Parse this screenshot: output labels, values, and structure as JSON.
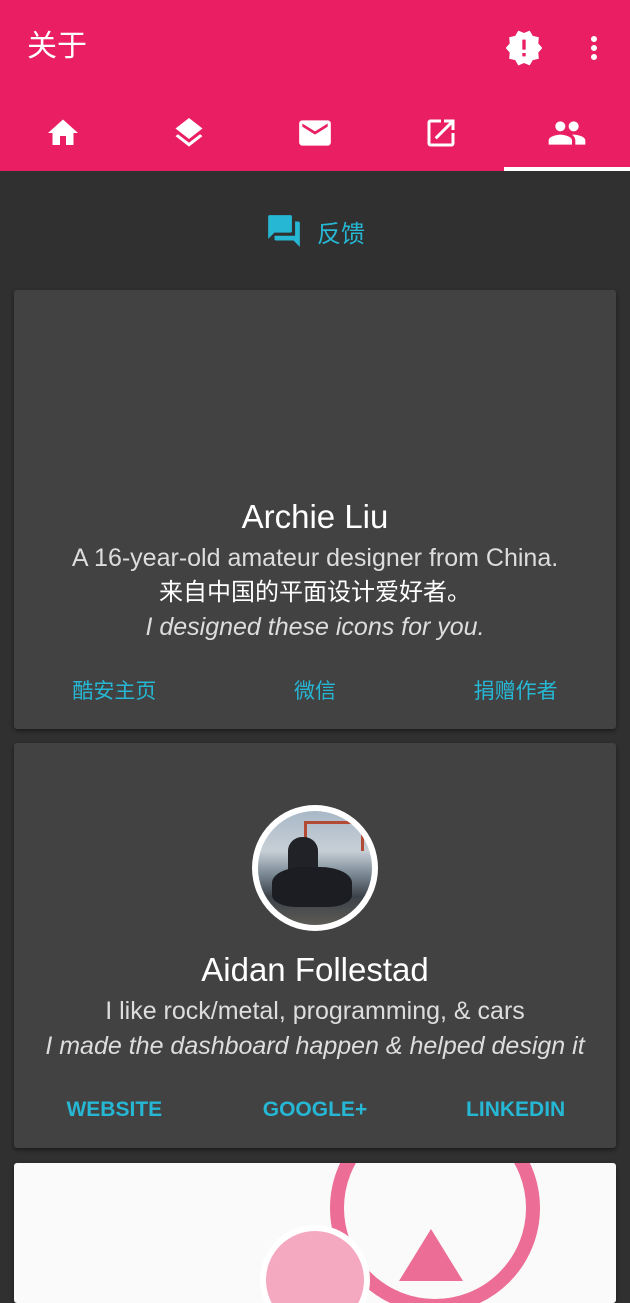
{
  "appbar": {
    "title": "关于",
    "color": "#e91e63",
    "actions": [
      "alert-decagram-icon",
      "more-vert-icon"
    ]
  },
  "tabs": {
    "items": [
      "home-icon",
      "layers-icon",
      "mail-icon",
      "open-external-icon",
      "people-icon"
    ],
    "selected_index": 4
  },
  "feedback": {
    "label": "反馈",
    "icon": "forum-icon",
    "color": "#26b7d4"
  },
  "cards": [
    {
      "name": "Archie Liu",
      "description": "A 16-year-old amateur designer from China.",
      "description_cn": "来自中国的平面设计爱好者。",
      "note": "I designed these icons for you.",
      "actions": [
        "酷安主页",
        "微信",
        "捐赠作者"
      ]
    },
    {
      "name": "Aidan Follestad",
      "description": "I like rock/metal, programming, & cars",
      "note": "I made the dashboard happen & helped design it",
      "actions": [
        "WEBSITE",
        "GOOGLE+",
        "LINKEDIN"
      ]
    }
  ],
  "accent_color": "#26b7d4"
}
